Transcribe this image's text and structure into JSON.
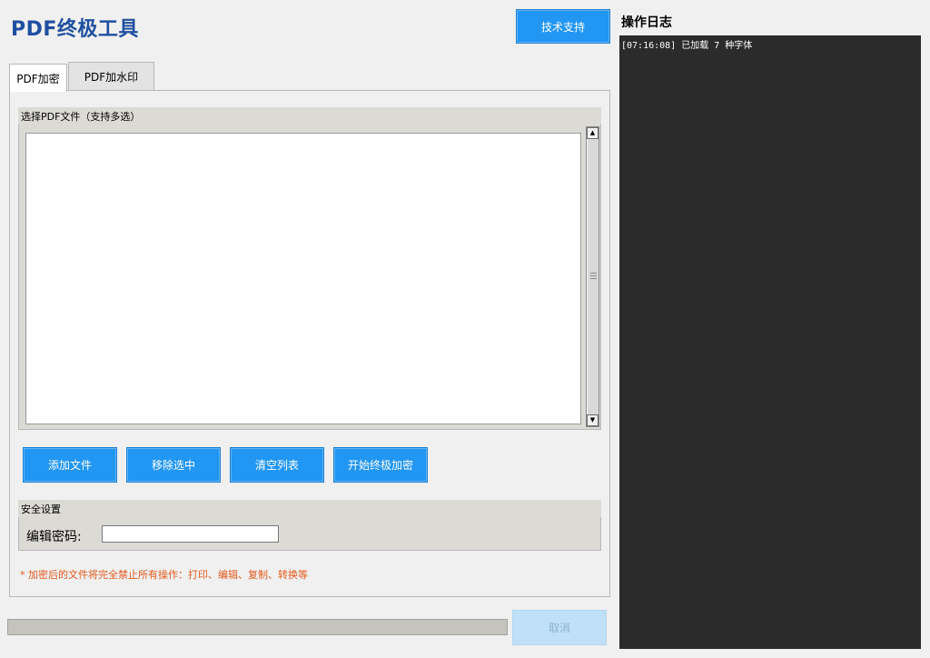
{
  "app": {
    "title": "PDF终极工具"
  },
  "header": {
    "support_label": "技术支持"
  },
  "tabs": [
    {
      "label": "PDF加密",
      "active": true
    },
    {
      "label": "PDF加水印",
      "active": false
    }
  ],
  "file_group": {
    "title": "选择PDF文件（支持多选）",
    "files": []
  },
  "actions": {
    "add_label": "添加文件",
    "remove_label": "移除选中",
    "clear_label": "清空列表",
    "start_label": "开始终极加密"
  },
  "security": {
    "title": "安全设置",
    "password_label": "编辑密码:",
    "password_value": "",
    "warning": "* 加密后的文件将完全禁止所有操作：打印、编辑、复制、转换等"
  },
  "progress": {
    "value": 0
  },
  "footer": {
    "cancel_label": "取消"
  },
  "log": {
    "title": "操作日志",
    "lines": [
      "[07:16:08] 已加载 7 种字体"
    ]
  },
  "colors": {
    "accent": "#2196f3",
    "title": "#1f4fa0",
    "warning": "#e25a1c",
    "log_bg": "#2b2b2b"
  }
}
